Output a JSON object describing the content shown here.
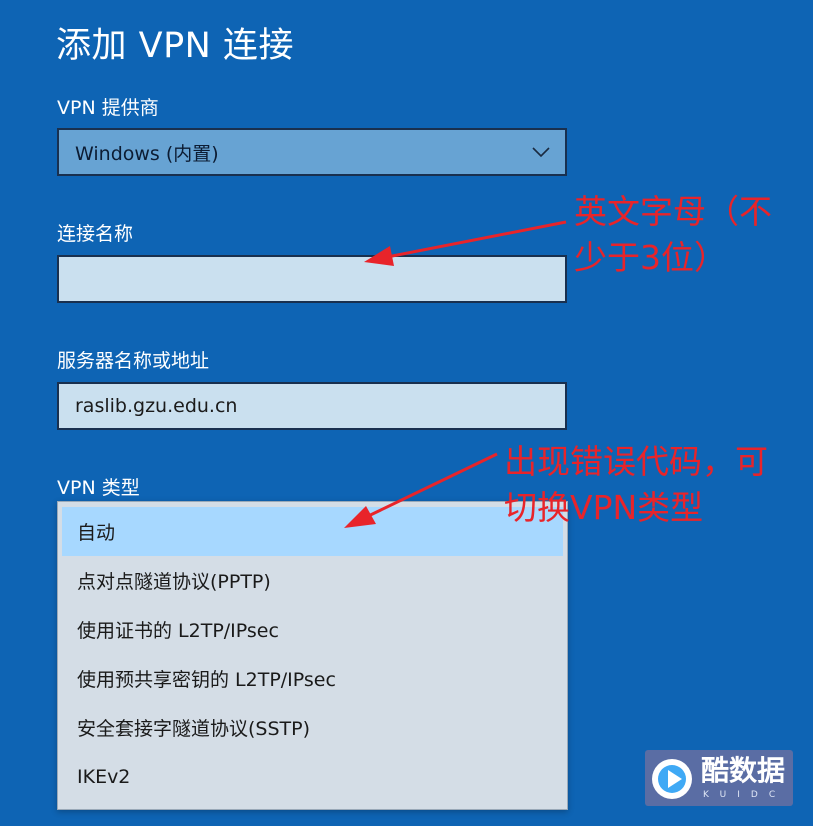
{
  "title": "添加 VPN 连接",
  "provider": {
    "label": "VPN 提供商",
    "value": "Windows (内置)"
  },
  "connection_name": {
    "label": "连接名称",
    "value": ""
  },
  "server": {
    "label": "服务器名称或地址",
    "value": "raslib.gzu.edu.cn"
  },
  "vpn_type": {
    "label": "VPN 类型",
    "options": [
      "自动",
      "点对点隧道协议(PPTP)",
      "使用证书的 L2TP/IPsec",
      "使用预共享密钥的 L2TP/IPsec",
      "安全套接字隧道协议(SSTP)",
      "IKEv2"
    ],
    "selected": "自动"
  },
  "annotations": {
    "name_hint_line1": "英文字母（不",
    "name_hint_line2": "少于3位）",
    "type_hint_line1": "出现错误代码，可",
    "type_hint_line2": "切换VPN类型",
    "color": "#E8242A"
  },
  "watermark": {
    "text": "酷数据",
    "sub": "KUIDC"
  },
  "colors": {
    "background": "#0E64B4",
    "select_fill": "#67A3D3",
    "input_fill": "#CAE0EF",
    "dropdown_bg": "#D4DDE6",
    "selected_item": "#A7D8FF"
  }
}
